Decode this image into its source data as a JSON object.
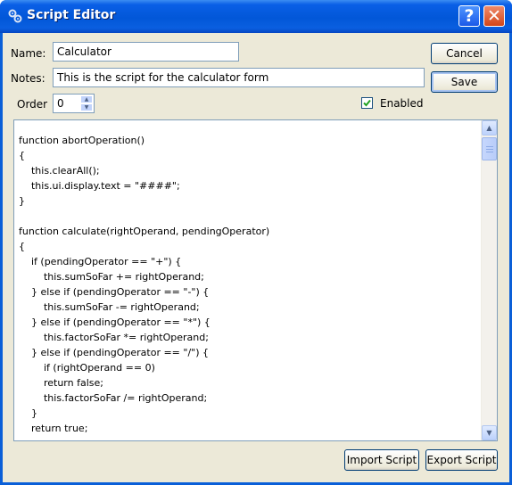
{
  "window": {
    "title": "Script Editor",
    "help_label": "?",
    "close_label": "✕"
  },
  "form": {
    "name_label": "Name:",
    "name_value": "Calculator",
    "notes_label": "Notes:",
    "notes_value": "This is the script for the calculator form",
    "order_label": "Order",
    "order_value": "0",
    "enabled_label": "Enabled",
    "enabled_checked": true
  },
  "buttons": {
    "cancel": "Cancel",
    "save": "Save",
    "import": "Import Script",
    "export": "Export Script"
  },
  "script": {
    "lines": [
      "function abortOperation()",
      "{",
      "    this.clearAll();",
      "    this.ui.display.text = \"####\";",
      "}",
      "",
      "function calculate(rightOperand, pendingOperator)",
      "{",
      "    if (pendingOperator == \"+\") {",
      "        this.sumSoFar += rightOperand;",
      "    } else if (pendingOperator == \"-\") {",
      "        this.sumSoFar -= rightOperand;",
      "    } else if (pendingOperator == \"*\") {",
      "        this.factorSoFar *= rightOperand;",
      "    } else if (pendingOperator == \"/\") {",
      "        if (rightOperand == 0)",
      "        return false;",
      "        this.factorSoFar /= rightOperand;",
      "    }",
      "    return true;"
    ]
  },
  "icons": {
    "app": "script-gears-icon",
    "spin_up": "arrow-up-icon",
    "spin_down": "arrow-down-icon",
    "scroll_up": "arrow-up-icon",
    "scroll_down": "arrow-down-icon",
    "check": "checkmark-icon"
  },
  "colors": {
    "titlebar": "#0a5fe6",
    "face": "#ece9d8",
    "check": "#21a121"
  }
}
